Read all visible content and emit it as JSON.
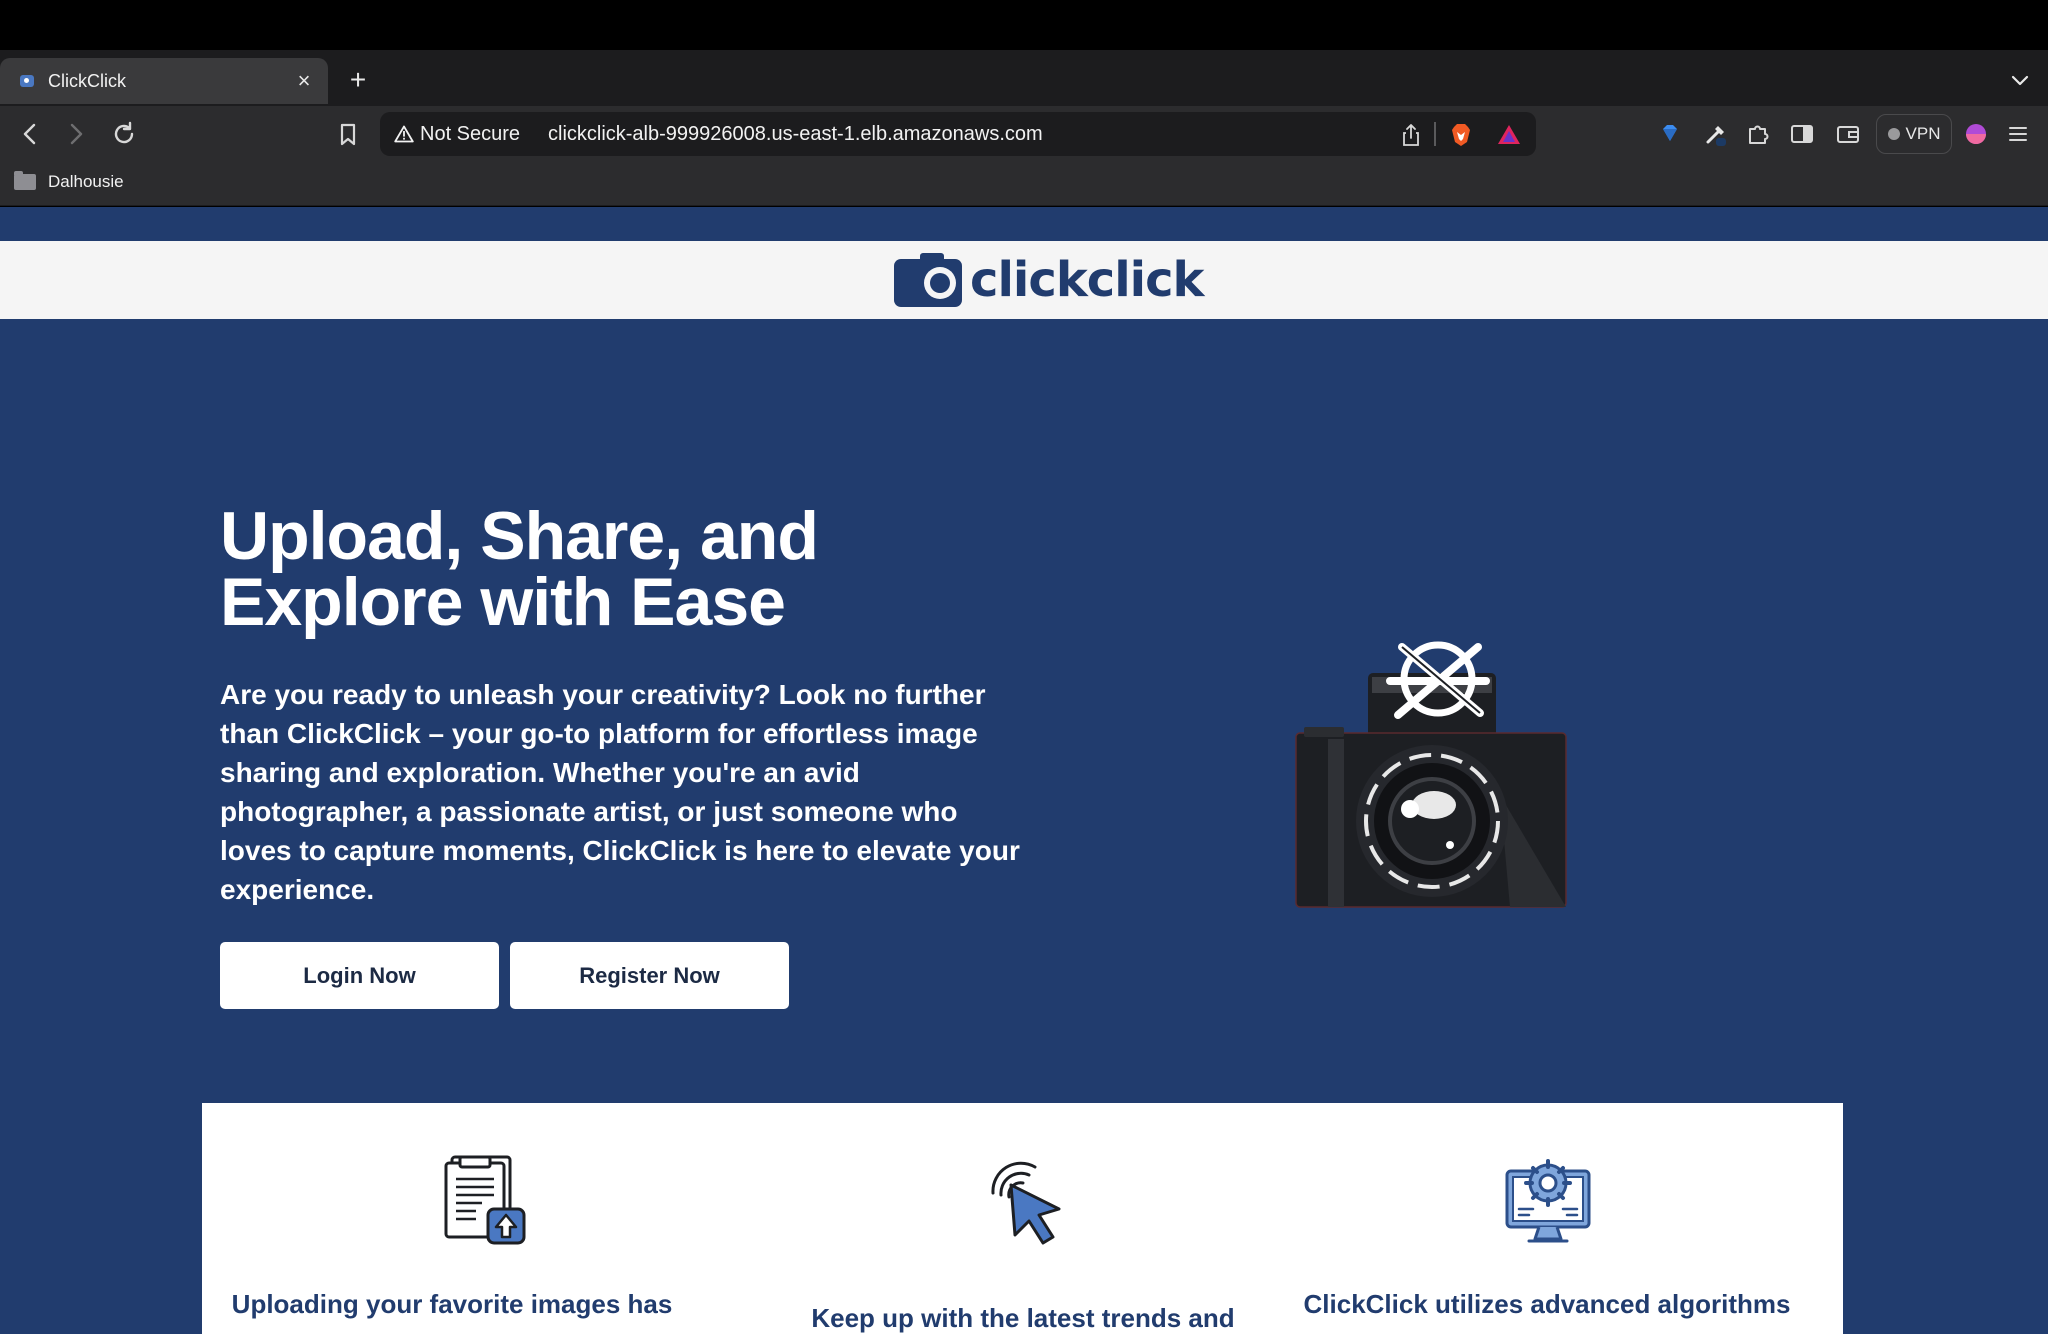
{
  "browser": {
    "tab_title": "ClickClick",
    "tab_close": "×",
    "new_tab": "+",
    "security_label": "Not Secure",
    "url": "clickclick-alb-999926008.us-east-1.elb.amazonaws.com",
    "vpn_label": "VPN",
    "bookmark_folder": "Dalhousie"
  },
  "site": {
    "logo_text": "clickclick",
    "hero_title_line1": "Upload, Share, and",
    "hero_title_line2": "Explore with Ease",
    "hero_text": "Are you ready to unleash your creativity? Look no further than ClickClick – your go-to platform for effortless image sharing and exploration. Whether you're an avid photographer, a passionate artist, or just someone who loves to capture moments, ClickClick is here to elevate your experience.",
    "login_button": "Login Now",
    "register_button": "Register Now",
    "features": [
      {
        "icon": "document-upload-icon",
        "text": "Uploading your favorite images has"
      },
      {
        "icon": "cursor-click-icon",
        "text": "Keep up with the latest trends and"
      },
      {
        "icon": "monitor-gear-icon",
        "text": "ClickClick utilizes advanced algorithms"
      }
    ]
  },
  "colors": {
    "brand_blue": "#213c6e",
    "header_bg": "#f5f5f5",
    "button_bg": "#ffffff"
  }
}
